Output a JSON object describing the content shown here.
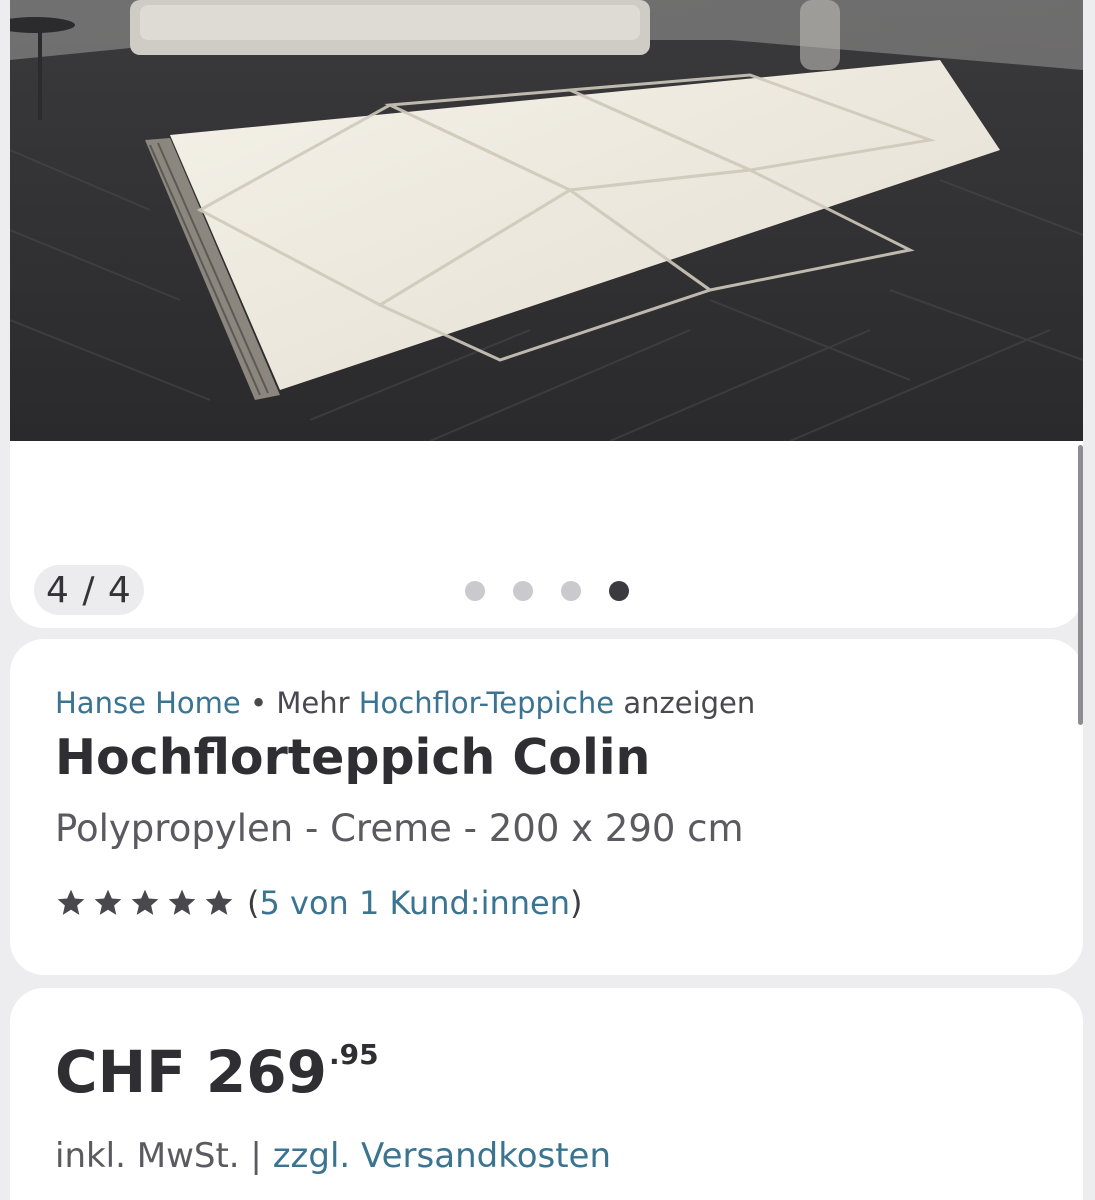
{
  "gallery": {
    "counter": "4 / 4",
    "dots_total": 4,
    "dots_active_index": 3
  },
  "breadcrumb": {
    "brand": "Hanse Home",
    "separator": "•",
    "prefix": "Mehr",
    "category": "Hochflor-Teppiche",
    "suffix": "anzeigen"
  },
  "product": {
    "title": "Hochflorteppich Colin",
    "subtitle": "Polypropylen - Creme - 200 x 290 cm"
  },
  "rating": {
    "stars": 5,
    "open_paren": "(",
    "link_text": "5 von 1 Kund:innen",
    "close_paren": ")"
  },
  "price": {
    "main": "CHF 269",
    "cents": ".95",
    "tax_note": "inkl. MwSt. |",
    "shipping_link": "zzgl. Versandkosten"
  },
  "colors": {
    "link": "#3a7491",
    "background": "#ededf0",
    "card": "#ffffff",
    "dot_active": "#3a3a40",
    "dot_inactive": "#c9c9ce"
  }
}
